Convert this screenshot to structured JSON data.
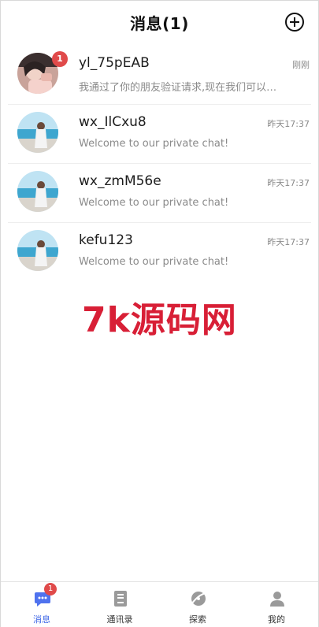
{
  "header": {
    "title": "消息(1)"
  },
  "conversations": [
    {
      "name": "yl_75pEAB",
      "time": "刚刚",
      "preview": "我通过了你的朋友验证请求,现在我们可以开始聊天了",
      "badge": "1"
    },
    {
      "name": "wx_IlCxu8",
      "time": "昨天17:37",
      "preview": "Welcome to our private chat!"
    },
    {
      "name": "wx_zmM56e",
      "time": "昨天17:37",
      "preview": "Welcome to our private chat!"
    },
    {
      "name": "kefu123",
      "time": "昨天17:37",
      "preview": "Welcome to our private chat!"
    }
  ],
  "watermark": "7k源码网",
  "tabs": [
    {
      "label": "消息",
      "icon": "chat-icon",
      "badge": "1",
      "active": true
    },
    {
      "label": "通讯录",
      "icon": "contacts-icon"
    },
    {
      "label": "探索",
      "icon": "explore-icon"
    },
    {
      "label": "我的",
      "icon": "profile-icon"
    }
  ],
  "colors": {
    "accent": "#3d66e6",
    "badge": "#e04a4a",
    "watermark": "#d81f36"
  }
}
